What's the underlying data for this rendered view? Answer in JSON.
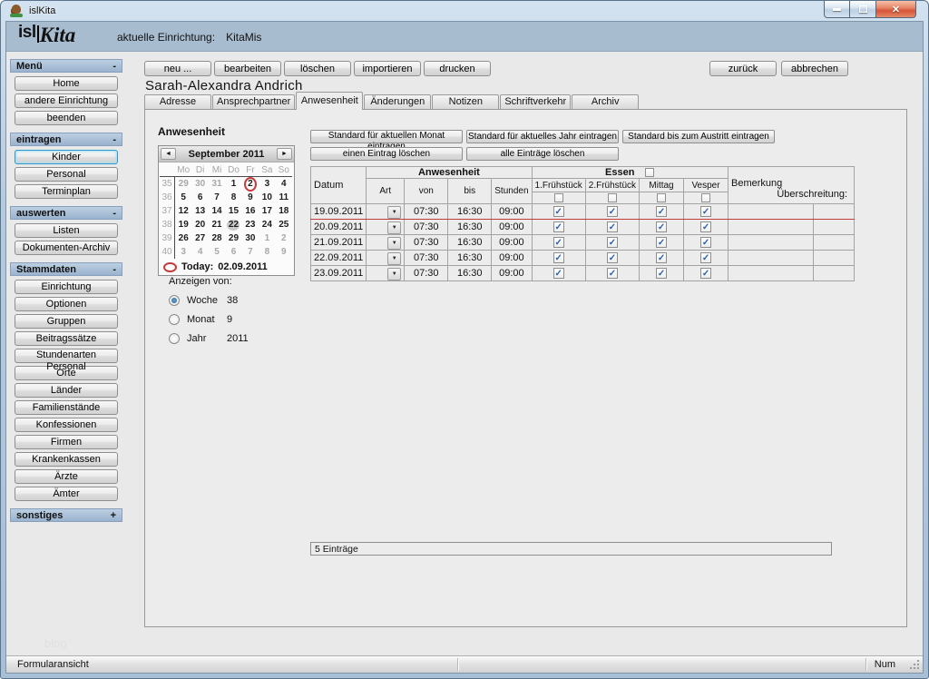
{
  "window": {
    "title": "islKita",
    "icons": {
      "close": "✕"
    }
  },
  "header": {
    "logo_primary": "isl",
    "logo_secondary": "Kita",
    "facility_label": "aktuelle Einrichtung:",
    "facility_value": "KitaMis"
  },
  "sidebar": {
    "active_item": "Kinder",
    "watermark": "blog",
    "sections": [
      {
        "label": "Menü",
        "toggle": "-",
        "items": [
          "Home",
          "andere Einrichtung",
          "beenden"
        ]
      },
      {
        "label": "eintragen",
        "toggle": "-",
        "items": [
          "Kinder",
          "Personal",
          "Terminplan"
        ]
      },
      {
        "label": "auswerten",
        "toggle": "-",
        "items": [
          "Listen",
          "Dokumenten-Archiv"
        ]
      },
      {
        "label": "Stammdaten",
        "toggle": "-",
        "items": [
          "Einrichtung",
          "Optionen",
          "Gruppen",
          "Beitragssätze",
          "Stundenarten Personal",
          "Orte",
          "Länder",
          "Familienstände",
          "Konfessionen",
          "Firmen",
          "Krankenkassen",
          "Ärzte",
          "Ämter"
        ]
      },
      {
        "label": "sonstiges",
        "toggle": "+",
        "items": []
      }
    ]
  },
  "toolbar": {
    "left": [
      "neu ...",
      "bearbeiten",
      "löschen",
      "importieren",
      "drucken"
    ],
    "right": [
      "zurück",
      "abbrechen"
    ]
  },
  "record_title": "Sarah-Alexandra Andrich",
  "tabs": {
    "active": "Anwesenheit",
    "items": [
      "Adresse",
      "Ansprechpartner",
      "Anwesenheit",
      "Änderungen",
      "Notizen",
      "Schriftverkehr",
      "Archiv"
    ]
  },
  "attendance": {
    "panel_title": "Anwesenheit",
    "calendar": {
      "title": "September 2011",
      "prev_icon": "◄",
      "next_icon": "►",
      "day_names": [
        "Mo",
        "Di",
        "Mi",
        "Do",
        "Fr",
        "Sa",
        "So"
      ],
      "weeks": [
        {
          "num": "35",
          "days": [
            {
              "t": "29",
              "muted": true
            },
            {
              "t": "30",
              "muted": true
            },
            {
              "t": "31",
              "muted": true
            },
            {
              "t": "1"
            },
            {
              "t": "2",
              "today": true
            },
            {
              "t": "3"
            },
            {
              "t": "4"
            }
          ]
        },
        {
          "num": "36",
          "days": [
            {
              "t": "5"
            },
            {
              "t": "6"
            },
            {
              "t": "7"
            },
            {
              "t": "8"
            },
            {
              "t": "9"
            },
            {
              "t": "10"
            },
            {
              "t": "11"
            }
          ]
        },
        {
          "num": "37",
          "days": [
            {
              "t": "12"
            },
            {
              "t": "13"
            },
            {
              "t": "14"
            },
            {
              "t": "15"
            },
            {
              "t": "16"
            },
            {
              "t": "17"
            },
            {
              "t": "18"
            }
          ]
        },
        {
          "num": "38",
          "days": [
            {
              "t": "19"
            },
            {
              "t": "20"
            },
            {
              "t": "21"
            },
            {
              "t": "22",
              "selected": true
            },
            {
              "t": "23"
            },
            {
              "t": "24"
            },
            {
              "t": "25"
            }
          ]
        },
        {
          "num": "39",
          "days": [
            {
              "t": "26"
            },
            {
              "t": "27"
            },
            {
              "t": "28"
            },
            {
              "t": "29"
            },
            {
              "t": "30"
            },
            {
              "t": "1",
              "muted": true
            },
            {
              "t": "2",
              "muted": true
            }
          ]
        },
        {
          "num": "40",
          "days": [
            {
              "t": "3",
              "muted": true
            },
            {
              "t": "4",
              "muted": true
            },
            {
              "t": "5",
              "muted": true
            },
            {
              "t": "6",
              "muted": true
            },
            {
              "t": "7",
              "muted": true
            },
            {
              "t": "8",
              "muted": true
            },
            {
              "t": "9",
              "muted": true
            }
          ]
        }
      ],
      "today_label": "Today:",
      "today_value": "02.09.2011"
    },
    "show_from": {
      "label": "Anzeigen von:",
      "options": [
        {
          "label": "Woche",
          "value": "38",
          "selected": true
        },
        {
          "label": "Monat",
          "value": "9",
          "selected": false
        },
        {
          "label": "Jahr",
          "value": "2011",
          "selected": false
        }
      ]
    },
    "actions_row1": [
      "Standard für aktuellen Monat eintragen",
      "Standard für aktuelles Jahr eintragen",
      "Standard bis zum Austritt eintragen"
    ],
    "actions_row2": [
      "einen Eintrag löschen",
      "alle Einträge löschen"
    ],
    "table": {
      "groups": {
        "anwesenheit": "Anwesenheit",
        "essen": "Essen"
      },
      "cols": {
        "datum": "Datum",
        "art": "Art",
        "von": "von",
        "bis": "bis",
        "stunden": "Stunden",
        "meal1": "1.Frühstück",
        "meal2": "2.Frühstück",
        "meal3": "Mittag",
        "meal4": "Vesper",
        "bemerkung": "Bemerkung",
        "ueberschreitung": "Überschreitung:"
      },
      "dropdown_icon": "▼",
      "check_icon": "✓",
      "rows": [
        {
          "datum": "19.09.2011",
          "art": "",
          "von": "07:30",
          "bis": "16:30",
          "stunden": "09:00",
          "meals": [
            true,
            true,
            true,
            true
          ],
          "bemerkung": "",
          "current": true
        },
        {
          "datum": "20.09.2011",
          "art": "",
          "von": "07:30",
          "bis": "16:30",
          "stunden": "09:00",
          "meals": [
            true,
            true,
            true,
            true
          ],
          "bemerkung": "",
          "current": false
        },
        {
          "datum": "21.09.2011",
          "art": "",
          "von": "07:30",
          "bis": "16:30",
          "stunden": "09:00",
          "meals": [
            true,
            true,
            true,
            true
          ],
          "bemerkung": "",
          "current": false
        },
        {
          "datum": "22.09.2011",
          "art": "",
          "von": "07:30",
          "bis": "16:30",
          "stunden": "09:00",
          "meals": [
            true,
            true,
            true,
            true
          ],
          "bemerkung": "",
          "current": false
        },
        {
          "datum": "23.09.2011",
          "art": "",
          "von": "07:30",
          "bis": "16:30",
          "stunden": "09:00",
          "meals": [
            true,
            true,
            true,
            true
          ],
          "bemerkung": "",
          "current": false
        }
      ]
    },
    "footer_count": "5  Einträge"
  },
  "statusbar": {
    "left": "Formularansicht",
    "right": "Num"
  },
  "colors": {
    "accent_red": "#c23b3b",
    "check_blue": "#2a5fad",
    "header_band": "#a8bcd0"
  }
}
